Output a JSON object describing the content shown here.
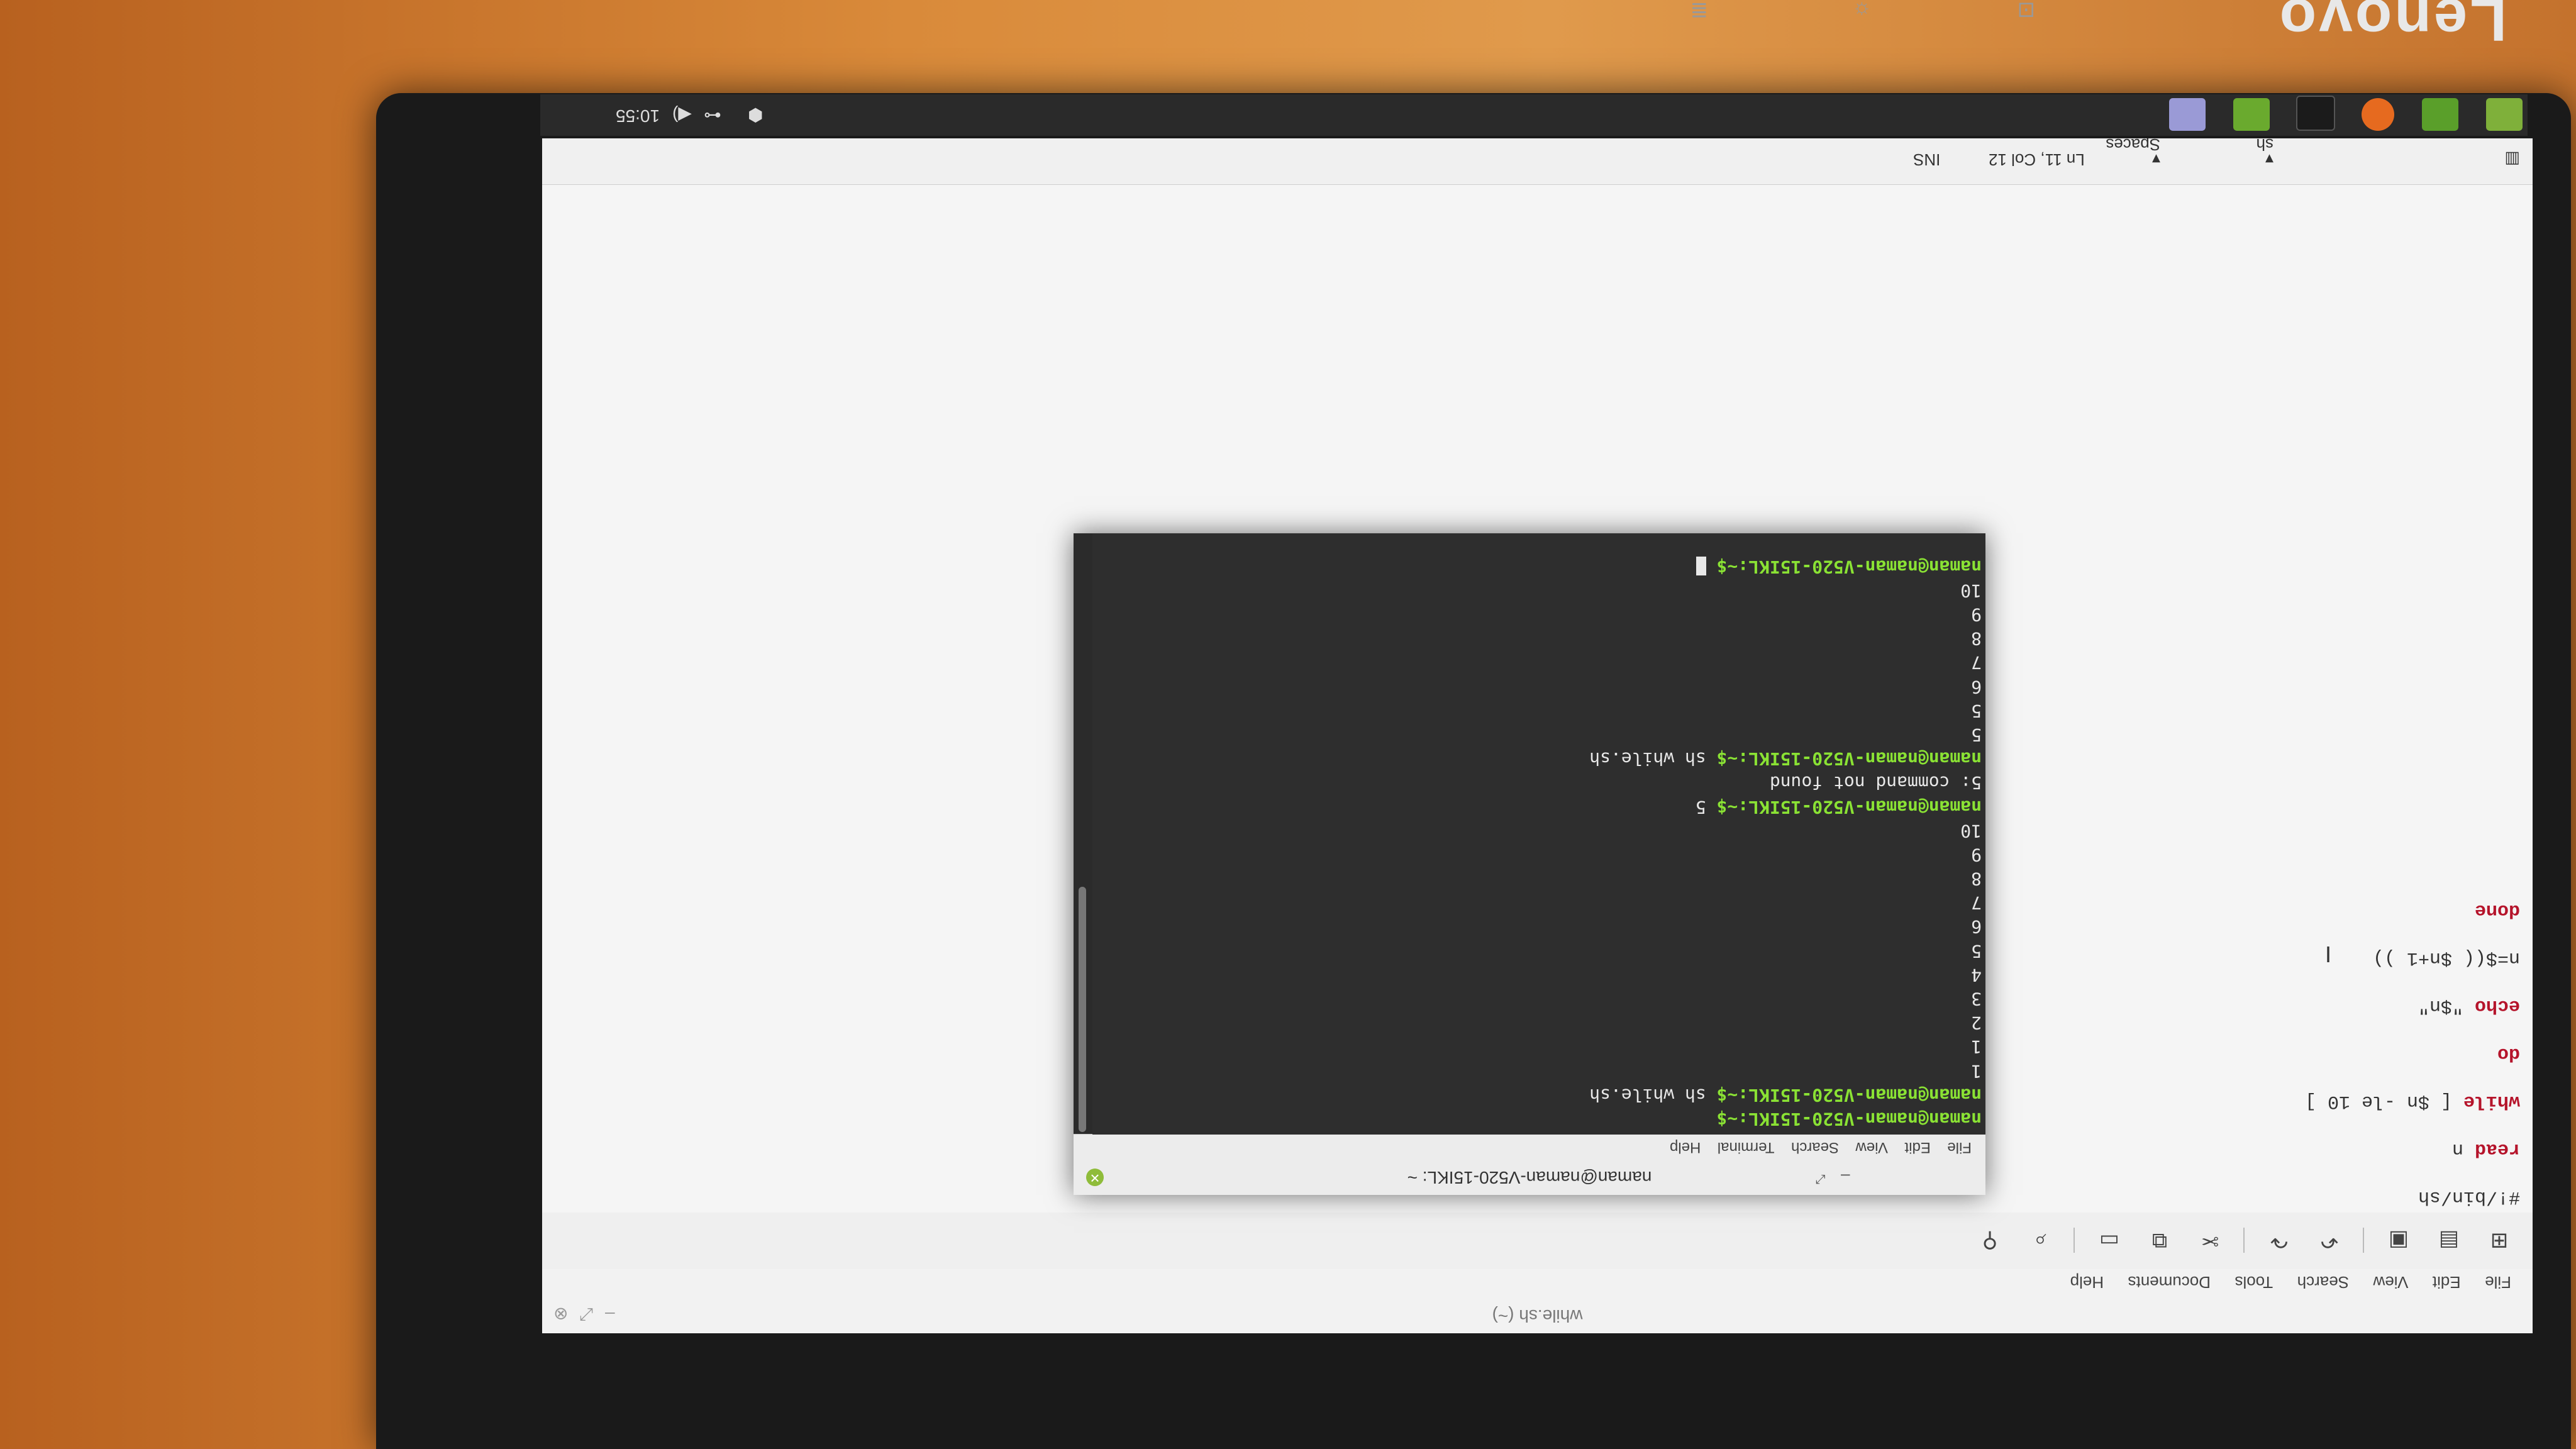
{
  "monitor": {
    "brand": "Lenovo"
  },
  "editor": {
    "title": "while.sh (~)",
    "menu": [
      "File",
      "Edit",
      "View",
      "Search",
      "Tools",
      "Documents",
      "Help"
    ],
    "code": {
      "line1": "#!/bin/sh",
      "line2_kw": "read",
      "line2_rest": " n",
      "line3_kw": "while",
      "line3_rest": " [ $n -le 10 ]",
      "line4_kw": "do",
      "line5_kw": "echo",
      "line5_rest": " \"$n\"",
      "line6": "n=$(( $n+1 ))",
      "line7_kw": "done"
    },
    "status": {
      "language": "sh",
      "indent": "Spaces",
      "position": "Ln 11, Col 12",
      "mode": "INS"
    }
  },
  "terminal": {
    "title": "naman@naman-V520-15IKL: ~",
    "menu": [
      "File",
      "Edit",
      "View",
      "Search",
      "Terminal",
      "Help"
    ],
    "prompt": "naman@naman-V520-15IKL:~$",
    "lines": [
      {
        "p": true,
        "t": ""
      },
      {
        "p": true,
        "t": " sh while.sh"
      },
      {
        "p": false,
        "t": "1"
      },
      {
        "p": false,
        "t": "1"
      },
      {
        "p": false,
        "t": "2"
      },
      {
        "p": false,
        "t": "3"
      },
      {
        "p": false,
        "t": "4"
      },
      {
        "p": false,
        "t": "5"
      },
      {
        "p": false,
        "t": "6"
      },
      {
        "p": false,
        "t": "7"
      },
      {
        "p": false,
        "t": "8"
      },
      {
        "p": false,
        "t": "9"
      },
      {
        "p": false,
        "t": "10"
      },
      {
        "p": true,
        "t": " 5"
      },
      {
        "p": false,
        "t": "5: command not found"
      },
      {
        "p": true,
        "t": " sh while.sh"
      },
      {
        "p": false,
        "t": "5"
      },
      {
        "p": false,
        "t": "5"
      },
      {
        "p": false,
        "t": "6"
      },
      {
        "p": false,
        "t": "7"
      },
      {
        "p": false,
        "t": "8"
      },
      {
        "p": false,
        "t": "9"
      },
      {
        "p": false,
        "t": "10"
      },
      {
        "p": true,
        "t": " ",
        "cursor": true
      }
    ]
  },
  "panel": {
    "clock": "10:55",
    "apps": [
      "menu",
      "files",
      "firefox",
      "terminal",
      "display",
      "editor"
    ]
  }
}
